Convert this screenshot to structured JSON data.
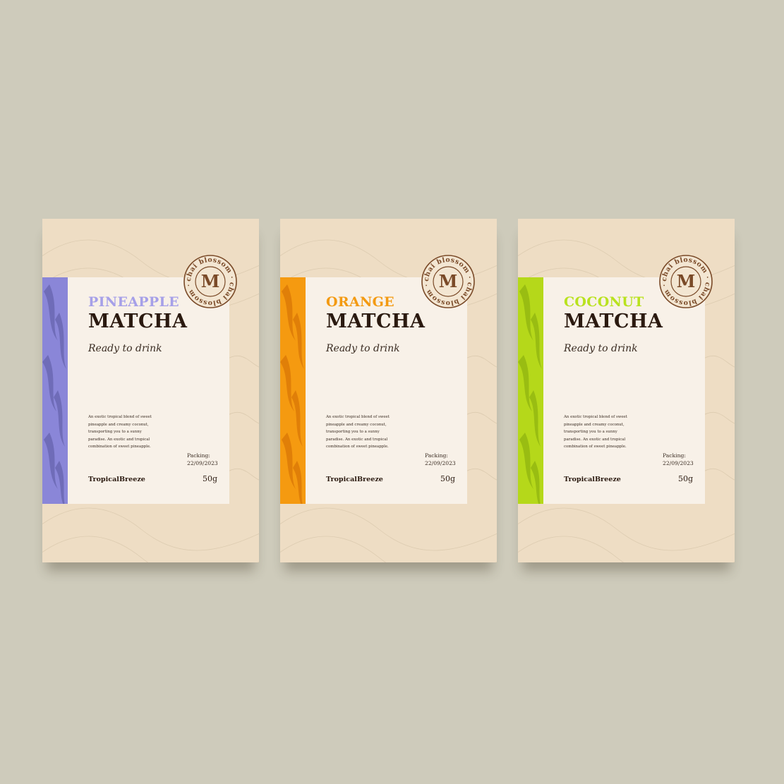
{
  "products": [
    {
      "flavor": "PINEAPPLE",
      "product": "MATCHA",
      "subtitle": "Ready to drink",
      "description": "An exotic tropical blend of sweet pineapple and creamy coconut, transporting you to a sunny paradise. An exotic and tropical combination of sweet pineapple.",
      "packing_label": "Packing:",
      "packing_date": "22/09/2023",
      "brand": "TropicalBreeze",
      "weight": "50g",
      "seal_text": "chai blossom · chai blossom ·",
      "seal_letter": "M",
      "accent_color": "#a6a0e8",
      "stripe_color": "#8a86d8",
      "stripe_dark": "#6f6cb8"
    },
    {
      "flavor": "ORANGE",
      "product": "MATCHA",
      "subtitle": "Ready to drink",
      "description": "An exotic tropical blend of sweet pineapple and creamy coconut, transporting you to a sunny paradise. An exotic and tropical combination of sweet pineapple.",
      "packing_label": "Packing:",
      "packing_date": "22/09/2023",
      "brand": "TropicalBreeze",
      "weight": "50g",
      "seal_text": "chai blossom · chai blossom ·",
      "seal_letter": "M",
      "accent_color": "#f39a12",
      "stripe_color": "#f59a10",
      "stripe_dark": "#e07f08"
    },
    {
      "flavor": "COCONUT",
      "product": "MATCHA",
      "subtitle": "Ready to drink",
      "description": "An exotic tropical blend of sweet pineapple and creamy coconut, transporting you to a sunny paradise. An exotic and tropical combination of sweet pineapple.",
      "packing_label": "Packing:",
      "packing_date": "22/09/2023",
      "brand": "TropicalBreeze",
      "weight": "50g",
      "seal_text": "chai blossom · chai blossom ·",
      "seal_letter": "M",
      "accent_color": "#b9e21e",
      "stripe_color": "#b5d81a",
      "stripe_dark": "#99bd12"
    }
  ],
  "colors": {
    "background": "#cecbbb",
    "card": "#eeddc4",
    "panel": "#f8f1e8",
    "ink": "#2b1a10",
    "seal": "#7a4a28"
  }
}
